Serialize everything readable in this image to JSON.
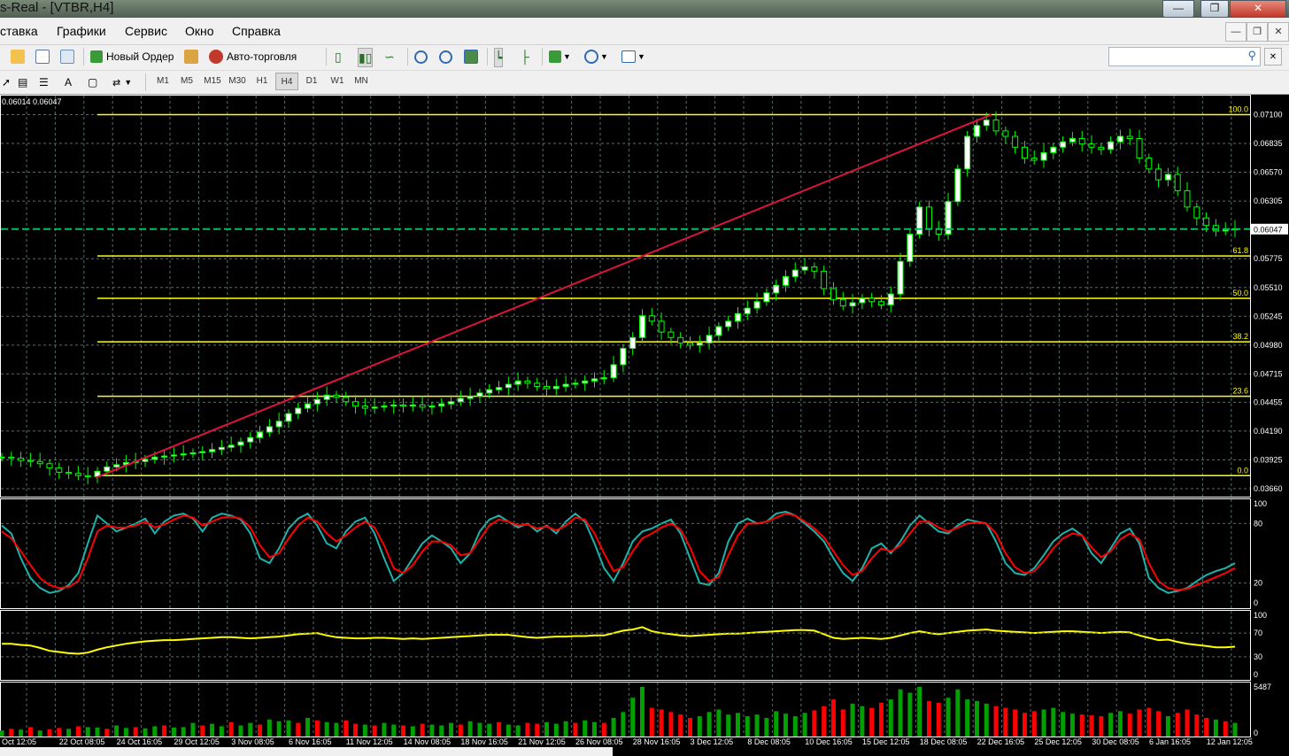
{
  "window": {
    "title": "s-Real - [VTBR,H4]"
  },
  "menu": [
    "ставка",
    "Графики",
    "Сервис",
    "Окно",
    "Справка"
  ],
  "toolbar": {
    "new_order": "Новый Ордер",
    "autotrade": "Авто-торговля",
    "search_placeholder": ""
  },
  "timeframes": [
    "M1",
    "M5",
    "M15",
    "M30",
    "H1",
    "H4",
    "D1",
    "W1",
    "MN"
  ],
  "active_timeframe": "H4",
  "colors": {
    "background": "#000000",
    "grid": "#5a6a6a",
    "bull_candle": "#ffffff",
    "bear_candle": "#000000",
    "candle_wick": "#00ff00",
    "fibo": "#ffff00",
    "trendline": "#dc143c",
    "bid_line": "#00c060",
    "stoch_main": "#20b2aa",
    "stoch_signal": "#ff0000",
    "rsi": "#ffff00",
    "volume_up": "#00a000",
    "volume_down": "#ff0000"
  },
  "chart_data": [
    {
      "type": "candlestick",
      "symbol": "VTBR",
      "timeframe": "H4",
      "header_text": "0.06014 0.06047",
      "current_price": "0.06047",
      "ylim": [
        0.0366,
        0.0712
      ],
      "y_ticks": [
        "0.07100",
        "0.06835",
        "0.06570",
        "0.06305",
        "0.05775",
        "0.05510",
        "0.05245",
        "0.04980",
        "0.04715",
        "0.04455",
        "0.04190",
        "0.03925",
        "0.03660"
      ],
      "x_ticks": [
        "Oct 12:05",
        "22 Oct 08:05",
        "24 Oct 16:05",
        "29 Oct 12:05",
        "3 Nov 08:05",
        "6 Nov 16:05",
        "11 Nov 12:05",
        "14 Nov 08:05",
        "18 Nov 16:05",
        "21 Nov 12:05",
        "26 Nov 08:05",
        "28 Nov 16:05",
        "3 Dec 12:05",
        "8 Dec 08:05",
        "10 Dec 16:05",
        "15 Dec 12:05",
        "18 Dec 08:05",
        "22 Dec 16:05",
        "25 Dec 12:05",
        "30 Dec 08:05",
        "6 Jan 16:05",
        "12 Jan 12:05"
      ],
      "fibonacci": [
        {
          "label": "100.0",
          "price": 0.071
        },
        {
          "label": "61.8",
          "price": 0.058
        },
        {
          "label": "50.0",
          "price": 0.0541
        },
        {
          "label": "38.2",
          "price": 0.0501
        },
        {
          "label": "23.6",
          "price": 0.0451
        },
        {
          "label": "0.0",
          "price": 0.0378
        }
      ],
      "trendline": {
        "from": 0.0376,
        "to": 0.071
      },
      "close_path": [
        0.0395,
        0.0394,
        0.0392,
        0.0391,
        0.0389,
        0.0385,
        0.0381,
        0.038,
        0.0378,
        0.0377,
        0.0382,
        0.0386,
        0.0388,
        0.039,
        0.0391,
        0.0393,
        0.0395,
        0.0396,
        0.0397,
        0.0398,
        0.0399,
        0.04,
        0.0402,
        0.0404,
        0.0406,
        0.0409,
        0.0413,
        0.0418,
        0.0423,
        0.0428,
        0.0435,
        0.044,
        0.0444,
        0.0448,
        0.0452,
        0.045,
        0.0446,
        0.0442,
        0.044,
        0.0441,
        0.0442,
        0.0443,
        0.0442,
        0.0443,
        0.0441,
        0.0442,
        0.0444,
        0.0446,
        0.0449,
        0.0451,
        0.0454,
        0.0457,
        0.0459,
        0.0462,
        0.0465,
        0.0463,
        0.046,
        0.0458,
        0.046,
        0.0462,
        0.0463,
        0.0465,
        0.0467,
        0.0468,
        0.048,
        0.0495,
        0.0505,
        0.0525,
        0.052,
        0.051,
        0.0505,
        0.05,
        0.0498,
        0.05,
        0.0507,
        0.0515,
        0.052,
        0.0527,
        0.0532,
        0.0538,
        0.0546,
        0.0553,
        0.0561,
        0.0567,
        0.057,
        0.0566,
        0.055,
        0.054,
        0.0534,
        0.0537,
        0.0541,
        0.0538,
        0.0535,
        0.0545,
        0.0575,
        0.06,
        0.0625,
        0.0605,
        0.06,
        0.063,
        0.066,
        0.069,
        0.07,
        0.0705,
        0.0695,
        0.069,
        0.068,
        0.067,
        0.0668,
        0.0675,
        0.068,
        0.0685,
        0.0688,
        0.0683,
        0.068,
        0.0678,
        0.0685,
        0.069,
        0.0688,
        0.067,
        0.066,
        0.065,
        0.0655,
        0.064,
        0.0625,
        0.0615,
        0.0608,
        0.0603,
        0.0604,
        0.0605
      ]
    },
    {
      "type": "line",
      "indicator": "Stochastic",
      "ylim": [
        0,
        100
      ],
      "y_ticks": [
        "100",
        "80",
        "20",
        "0"
      ],
      "series": [
        {
          "values": [
            78,
            70,
            45,
            25,
            15,
            10,
            12,
            18,
            30,
            60,
            88,
            80,
            72,
            76,
            80,
            85,
            70,
            82,
            88,
            90,
            85,
            72,
            86,
            90,
            88,
            84,
            70,
            45,
            40,
            55,
            75,
            85,
            90,
            78,
            60,
            55,
            72,
            82,
            86,
            70,
            45,
            22,
            30,
            45,
            60,
            68,
            62,
            55,
            40,
            50,
            72,
            84,
            88,
            82,
            76,
            80,
            72,
            78,
            70,
            82,
            90,
            82,
            60,
            35,
            22,
            40,
            62,
            72,
            75,
            80,
            84,
            70,
            45,
            20,
            18,
            30,
            62,
            80,
            85,
            80,
            82,
            90,
            92,
            88,
            80,
            72,
            62,
            45,
            30,
            22,
            35,
            55,
            60,
            50,
            62,
            78,
            88,
            80,
            72,
            70,
            78,
            84,
            82,
            80,
            62,
            40,
            30,
            28,
            35,
            48,
            62,
            70,
            75,
            68,
            50,
            40,
            55,
            70,
            75,
            60,
            25,
            15,
            10,
            12,
            15,
            22,
            28,
            32,
            35,
            40
          ]
        },
        {
          "values": [
            72,
            65,
            52,
            38,
            25,
            18,
            15,
            16,
            22,
            45,
            72,
            78,
            76,
            76,
            78,
            82,
            76,
            79,
            84,
            88,
            86,
            78,
            82,
            86,
            87,
            85,
            76,
            58,
            46,
            50,
            65,
            78,
            86,
            82,
            70,
            62,
            68,
            76,
            82,
            76,
            58,
            35,
            30,
            38,
            52,
            62,
            62,
            58,
            48,
            50,
            64,
            78,
            84,
            82,
            78,
            79,
            75,
            77,
            73,
            78,
            86,
            84,
            70,
            50,
            32,
            36,
            52,
            65,
            70,
            76,
            80,
            74,
            56,
            32,
            22,
            26,
            48,
            68,
            80,
            80,
            82,
            86,
            90,
            88,
            82,
            75,
            66,
            52,
            38,
            28,
            32,
            45,
            55,
            52,
            58,
            70,
            82,
            82,
            76,
            72,
            76,
            80,
            81,
            80,
            70,
            50,
            36,
            30,
            32,
            42,
            55,
            65,
            70,
            68,
            56,
            46,
            52,
            64,
            70,
            64,
            40,
            22,
            15,
            13,
            14,
            18,
            22,
            26,
            30,
            35
          ]
        }
      ]
    },
    {
      "type": "line",
      "indicator": "RSI",
      "ylim": [
        0,
        100
      ],
      "y_ticks": [
        "100",
        "70",
        "30",
        "0"
      ],
      "series": [
        {
          "values": [
            52,
            52,
            50,
            49,
            45,
            40,
            38,
            36,
            35,
            37,
            42,
            46,
            49,
            52,
            54,
            56,
            57,
            58,
            58,
            59,
            60,
            61,
            62,
            63,
            63,
            62,
            61,
            62,
            63,
            64,
            66,
            68,
            69,
            70,
            66,
            63,
            62,
            61,
            61,
            62,
            62,
            61,
            60,
            61,
            60,
            61,
            62,
            63,
            64,
            65,
            66,
            67,
            67,
            67,
            65,
            63,
            62,
            63,
            64,
            64,
            65,
            65,
            66,
            66,
            70,
            74,
            76,
            80,
            73,
            70,
            68,
            66,
            65,
            66,
            67,
            68,
            69,
            69,
            70,
            71,
            72,
            73,
            74,
            75,
            75,
            74,
            68,
            62,
            60,
            61,
            62,
            61,
            60,
            62,
            66,
            70,
            73,
            70,
            68,
            70,
            72,
            74,
            75,
            76,
            74,
            73,
            72,
            71,
            70,
            71,
            72,
            73,
            73,
            72,
            71,
            70,
            71,
            72,
            71,
            66,
            62,
            58,
            59,
            55,
            52,
            50,
            48,
            46,
            46,
            47
          ]
        }
      ]
    },
    {
      "type": "bar",
      "indicator": "Volumes",
      "y_ticks": [
        "5487",
        "0"
      ],
      "values": [
        300,
        500,
        400,
        700,
        300,
        450,
        600,
        500,
        800,
        700,
        650,
        500,
        900,
        600,
        700,
        550,
        800,
        900,
        650,
        700,
        1200,
        900,
        1100,
        800,
        1300,
        900,
        1200,
        1000,
        1600,
        1400,
        1500,
        1200,
        1800,
        1500,
        1300,
        1200,
        1500,
        1100,
        1000,
        900,
        1200,
        1000,
        900,
        800,
        1100,
        1000,
        900,
        1200,
        1000,
        1400,
        1200,
        1100,
        1300,
        1000,
        900,
        1200,
        1100,
        1300,
        1100,
        1400,
        1200,
        1500,
        1300,
        1200,
        1800,
        2500,
        4200,
        5487,
        3000,
        2800,
        2500,
        2200,
        1800,
        2000,
        2500,
        2800,
        2200,
        2400,
        2000,
        2200,
        1800,
        2600,
        2300,
        2000,
        2400,
        2700,
        3200,
        4000,
        2800,
        3500,
        3200,
        3000,
        3600,
        4000,
        5200,
        4800,
        5487,
        3800,
        3600,
        4200,
        5200,
        4000,
        3800,
        3500,
        3200,
        3000,
        2800,
        2400,
        2600,
        2800,
        3000,
        2500,
        2300,
        2200,
        2100,
        2000,
        2400,
        2600,
        2300,
        2800,
        3000,
        2600,
        2000,
        2400,
        2800,
        2200,
        1800,
        1600,
        1400,
        1200
      ],
      "bar_directions": [
        1,
        0,
        1,
        0,
        1,
        0,
        0,
        1,
        0,
        1,
        1,
        0,
        1,
        1,
        0,
        1,
        1,
        0,
        1,
        1,
        1,
        0,
        1,
        1,
        0,
        1,
        1,
        0,
        1,
        1,
        1,
        0,
        1,
        0,
        1,
        1,
        0,
        0,
        1,
        0,
        1,
        1,
        0,
        1,
        0,
        1,
        1,
        1,
        0,
        1,
        1,
        1,
        0,
        1,
        1,
        0,
        0,
        1,
        1,
        1,
        0,
        1,
        1,
        0,
        1,
        1,
        1,
        1,
        0,
        0,
        0,
        0,
        0,
        1,
        1,
        1,
        1,
        1,
        1,
        1,
        1,
        1,
        1,
        1,
        1,
        0,
        0,
        0,
        0,
        1,
        1,
        0,
        0,
        1,
        1,
        1,
        1,
        0,
        0,
        1,
        1,
        1,
        1,
        1,
        0,
        0,
        0,
        0,
        0,
        1,
        1,
        1,
        1,
        0,
        0,
        0,
        1,
        1,
        0,
        0,
        0,
        0,
        1,
        0,
        0,
        0,
        0,
        1,
        0,
        1
      ]
    }
  ]
}
